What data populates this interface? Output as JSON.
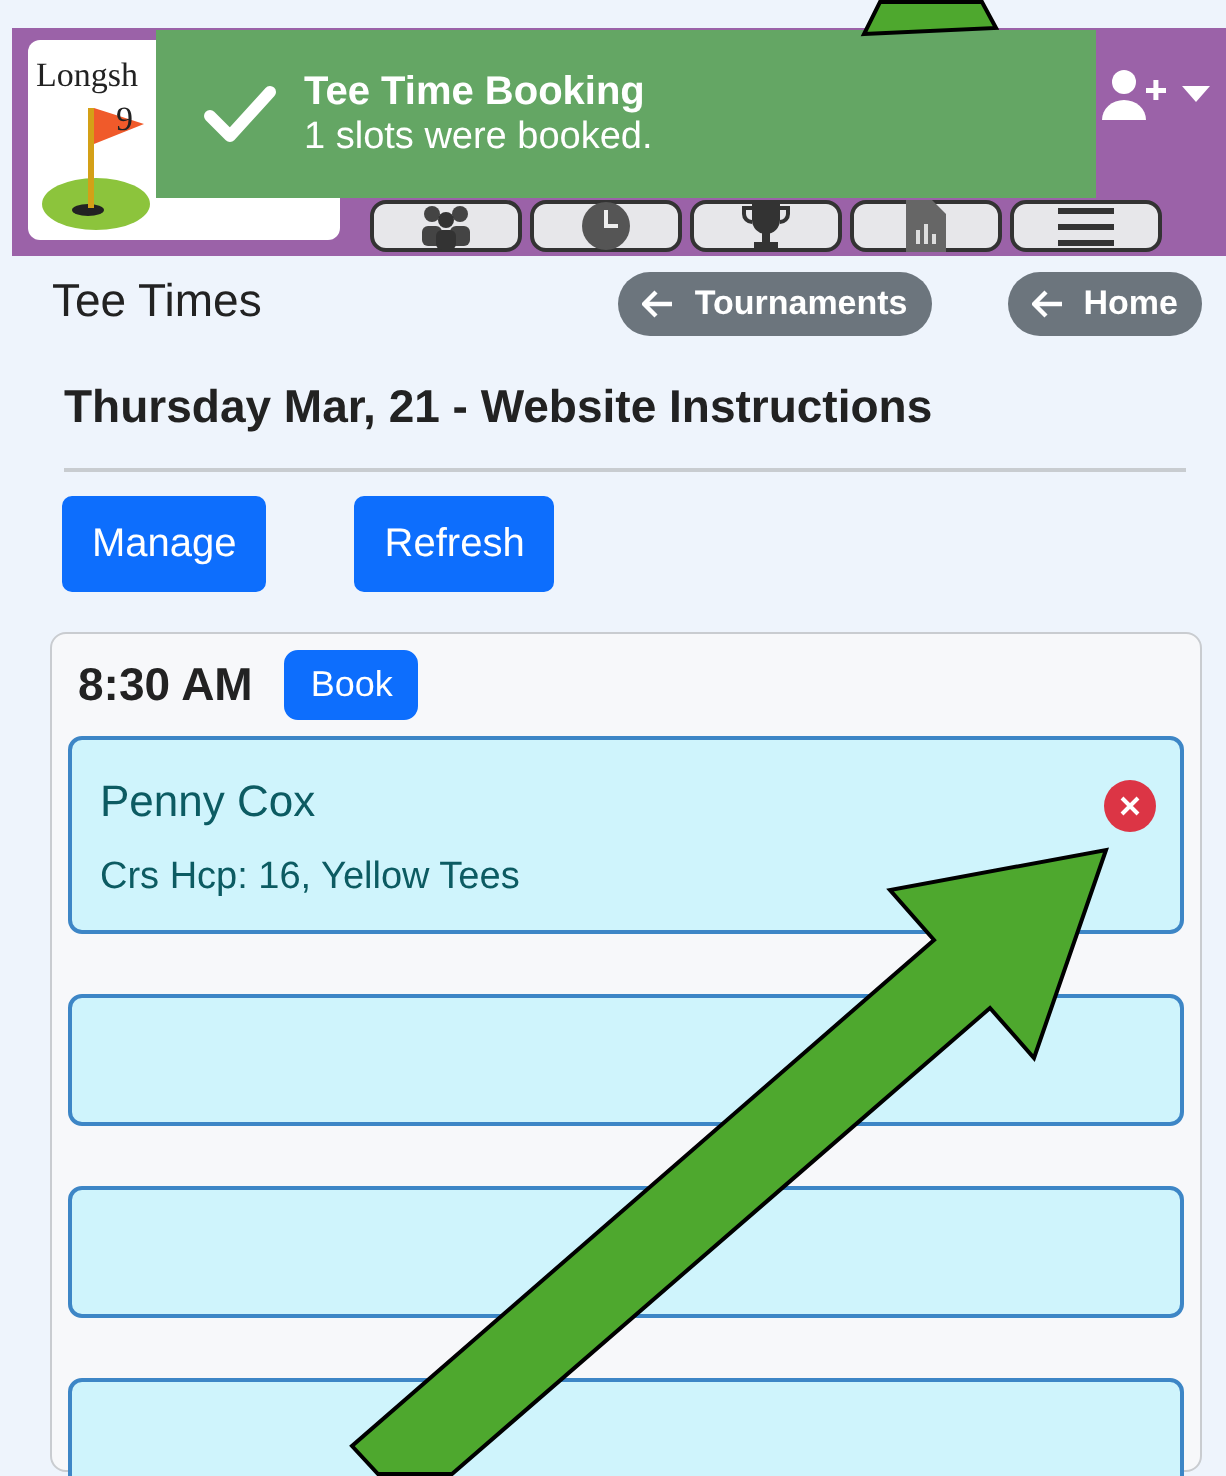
{
  "header": {
    "logo_lines": [
      "Longsh",
      "9"
    ]
  },
  "toast": {
    "title": "Tee Time Booking",
    "message": "1 slots were booked."
  },
  "page": {
    "title": "Tee Times",
    "back_buttons": [
      "Tournaments",
      "Home"
    ],
    "heading": "Thursday Mar, 21 - Website Instructions",
    "actions": [
      "Manage",
      "Refresh"
    ]
  },
  "tee_time": {
    "time": "8:30 AM",
    "book_label": "Book",
    "slots": [
      {
        "kind": "player",
        "name": "Penny Cox",
        "details": "Crs Hcp: 16, Yellow Tees"
      },
      {
        "kind": "empty"
      },
      {
        "kind": "empty"
      },
      {
        "kind": "empty"
      }
    ]
  }
}
